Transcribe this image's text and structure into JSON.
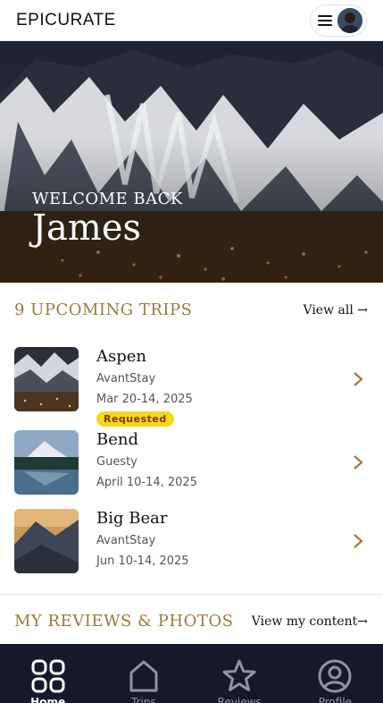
{
  "header": {
    "brand": "EPICURATE"
  },
  "hero": {
    "welcome": "WELCOME BACK",
    "name": "James"
  },
  "trips": {
    "title": "9 UPCOMING TRIPS",
    "view_all": "View all →",
    "items": [
      {
        "name": "Aspen",
        "host": "AvantStay",
        "dates": "Mar 20-14, 2025",
        "badge": "Requested"
      },
      {
        "name": "Bend",
        "host": "Guesty",
        "dates": "April 10-14, 2025"
      },
      {
        "name": "Big Bear",
        "host": "AvantStay",
        "dates": "Jun 10-14, 2025"
      }
    ]
  },
  "reviews": {
    "title": "MY REVIEWS & PHOTOS",
    "view_link": "View my content→"
  },
  "nav": {
    "items": [
      {
        "label": "Home",
        "icon": "grid-icon",
        "active": true
      },
      {
        "label": "Trips",
        "icon": "house-icon"
      },
      {
        "label": "Reviews",
        "icon": "star-icon"
      },
      {
        "label": "Profile",
        "icon": "user-circle-icon"
      }
    ]
  },
  "colors": {
    "accent": "#9b7a3c",
    "nav_bg": "#16192b",
    "badge": "#f5d71c"
  }
}
